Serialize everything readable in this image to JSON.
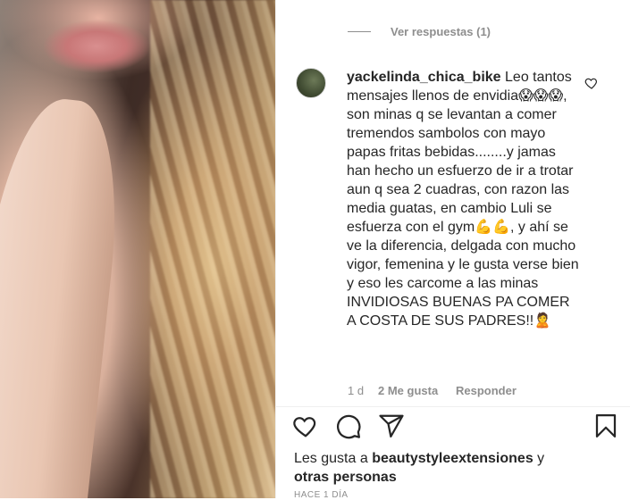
{
  "comments": {
    "view_replies": "Ver respuestas (1)",
    "comment": {
      "username": "yackelinda_chica_bike",
      "text": "Leo tantos mensajes llenos de envidia😱😱😱, son minas q se levantan a comer tremendos sambolos con mayo papas fritas bebidas........y jamas han hecho un esfuerzo de ir a trotar aun q sea 2 cuadras, con razon las media guatas, en cambio Luli se esfuerza con el gym💪💪, y ahí se ve la diferencia, delgada con mucho vigor, femenina y le gusta verse bien y eso les carcome a las minas INVIDIOSAS BUENAS PA COMER A COSTA DE SUS PADRES!!🙎",
      "age": "1 d",
      "likes": "2 Me gusta",
      "reply": "Responder"
    }
  },
  "actions": {
    "like_icon": "heart-icon",
    "comment_icon": "comment-bubble-icon",
    "share_icon": "paper-plane-icon",
    "save_icon": "bookmark-icon"
  },
  "likes_summary": {
    "prefix": "Les gusta a",
    "user": "beautystyleextensiones",
    "connector": "y",
    "others": "otras personas"
  },
  "date": "HACE 1 DÍA"
}
